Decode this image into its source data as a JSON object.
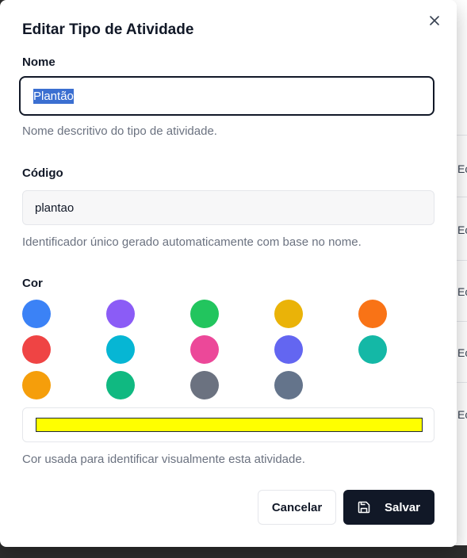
{
  "background": {
    "row_cells": [
      "Ec",
      "Ec",
      "Ec",
      "Ec",
      "Ec"
    ]
  },
  "dialog": {
    "title": "Editar Tipo de Atividade",
    "close_icon": "close-icon"
  },
  "name_field": {
    "label": "Nome",
    "value": "Plantão",
    "help": "Nome descritivo do tipo de atividade."
  },
  "code_field": {
    "label": "Código",
    "value": "plantao",
    "help": "Identificador único gerado automaticamente com base no nome."
  },
  "color_field": {
    "label": "Cor",
    "swatches": [
      "#3b82f6",
      "#8b5cf6",
      "#22c55e",
      "#eab308",
      "#f97316",
      "#ef4444",
      "#06b6d4",
      "#ec4899",
      "#6366f1",
      "#14b8a6",
      "#f59e0b",
      "#10b981",
      "#6b7280",
      "#64748b"
    ],
    "selected_color": "#ffff00",
    "help": "Cor usada para identificar visualmente esta atividade."
  },
  "actions": {
    "cancel_label": "Cancelar",
    "save_label": "Salvar",
    "save_icon": "save-icon"
  }
}
